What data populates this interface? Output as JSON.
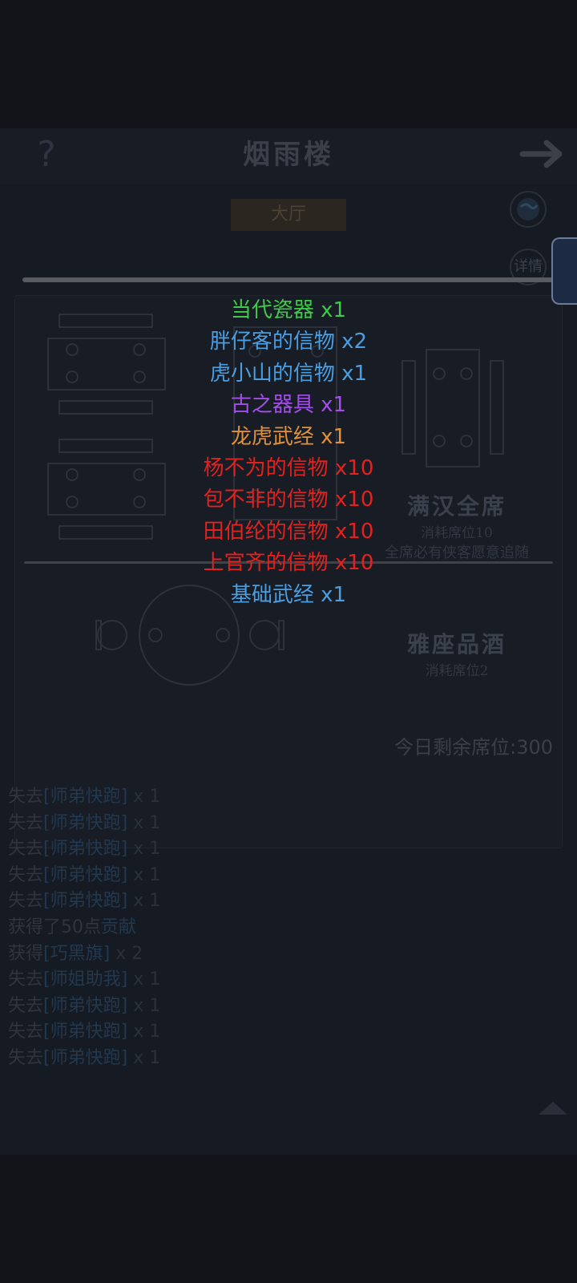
{
  "header": {
    "title": "烟雨楼",
    "help_symbol": "?"
  },
  "tabs": {
    "active": "大厅"
  },
  "side_buttons": {
    "details_label": "详情"
  },
  "seats": [
    {
      "name": "满汉全席",
      "cost": "消耗席位10",
      "note": "全席必有侠客愿意追随"
    },
    {
      "name": "雅座品酒",
      "cost": "消耗席位2"
    }
  ],
  "seats_left": {
    "label": "今日剩余席位:",
    "value": "300"
  },
  "log": [
    {
      "prefix": "失去",
      "item": "[师弟快跑]",
      "qty": "x 1"
    },
    {
      "prefix": "失去",
      "item": "[师弟快跑]",
      "qty": "x 1"
    },
    {
      "prefix": "失去",
      "item": "[师弟快跑]",
      "qty": "x 1"
    },
    {
      "prefix": "失去",
      "item": "[师弟快跑]",
      "qty": "x 1"
    },
    {
      "prefix": "失去",
      "item": "[师弟快跑]",
      "qty": "x 1"
    },
    {
      "prefix": "获得了50点",
      "item": "贡献",
      "qty": ""
    },
    {
      "prefix": "获得",
      "item": "[巧黑旗]",
      "qty": "x 2"
    },
    {
      "prefix": "失去",
      "item": "[师姐助我]",
      "qty": "x 1"
    },
    {
      "prefix": "失去",
      "item": "[师弟快跑]",
      "qty": "x 1"
    },
    {
      "prefix": "失去",
      "item": "[师弟快跑]",
      "qty": "x 1"
    },
    {
      "prefix": "失去",
      "item": "[师弟快跑]",
      "qty": "x 1"
    }
  ],
  "rewards": [
    {
      "name": "当代瓷器",
      "qty": "x1",
      "color": "#3ec94a"
    },
    {
      "name": "胖仔客的信物",
      "qty": "x2",
      "color": "#4a9ee2"
    },
    {
      "name": "虎小山的信物",
      "qty": "x1",
      "color": "#4a9ee2"
    },
    {
      "name": "古之器具",
      "qty": "x1",
      "color": "#a24ee8"
    },
    {
      "name": "龙虎武经",
      "qty": "x1",
      "color": "#e0913a"
    },
    {
      "name": "杨不为的信物",
      "qty": "x10",
      "color": "#e1221f"
    },
    {
      "name": "包不非的信物",
      "qty": "x10",
      "color": "#e1221f"
    },
    {
      "name": "田伯纶的信物",
      "qty": "x10",
      "color": "#e1221f"
    },
    {
      "name": "上官齐的信物",
      "qty": "x10",
      "color": "#e1221f"
    },
    {
      "name": "基础武经",
      "qty": "x1",
      "color": "#4a9ee2"
    }
  ]
}
